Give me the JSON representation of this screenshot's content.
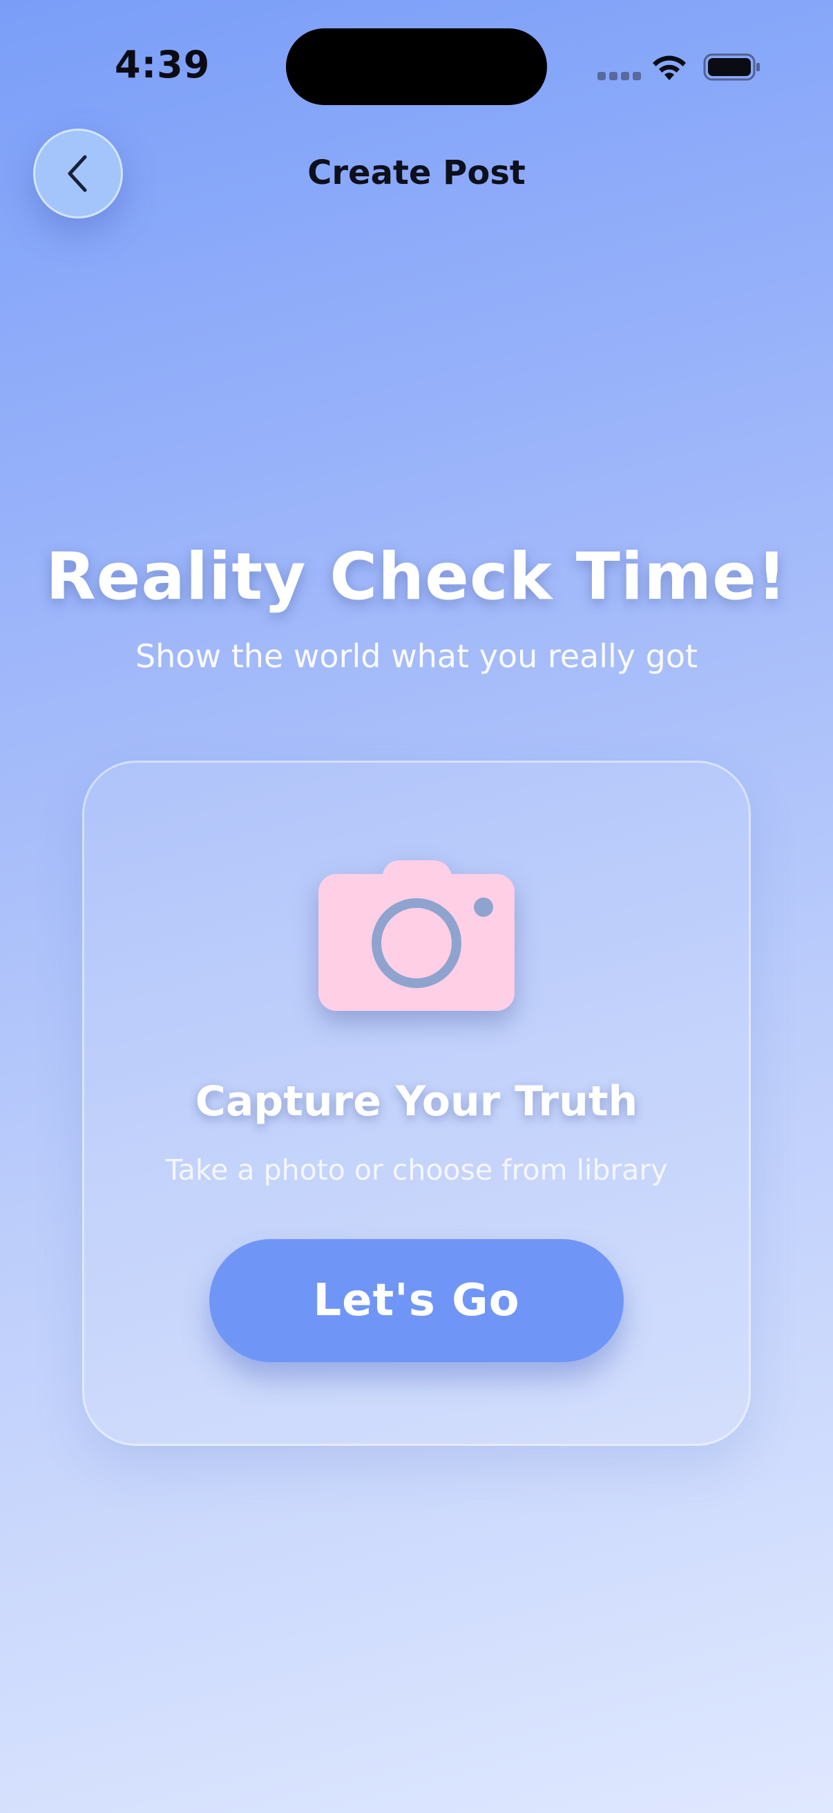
{
  "status_bar": {
    "time": "4:39",
    "icons": [
      "signal-dots-icon",
      "wifi-icon",
      "battery-icon"
    ]
  },
  "nav": {
    "back_icon": "chevron-left-icon",
    "title": "Create Post"
  },
  "hero": {
    "title": "Reality Check Time!",
    "subtitle": "Show the world what you really got"
  },
  "card": {
    "icon": "camera-icon",
    "title": "Capture Your Truth",
    "subtitle": "Take a photo or choose from library",
    "button_label": "Let's Go"
  },
  "colors": {
    "background_top": "#7a9ef8",
    "background_bottom": "#dfe8fe",
    "back_button": "#a3c5fb",
    "primary_button": "#6f96f6",
    "camera_body": "#ffcfe6",
    "camera_lens": "#8fa3cf",
    "text_dark": "#0e0f1c",
    "text_light": "#ffffff"
  }
}
